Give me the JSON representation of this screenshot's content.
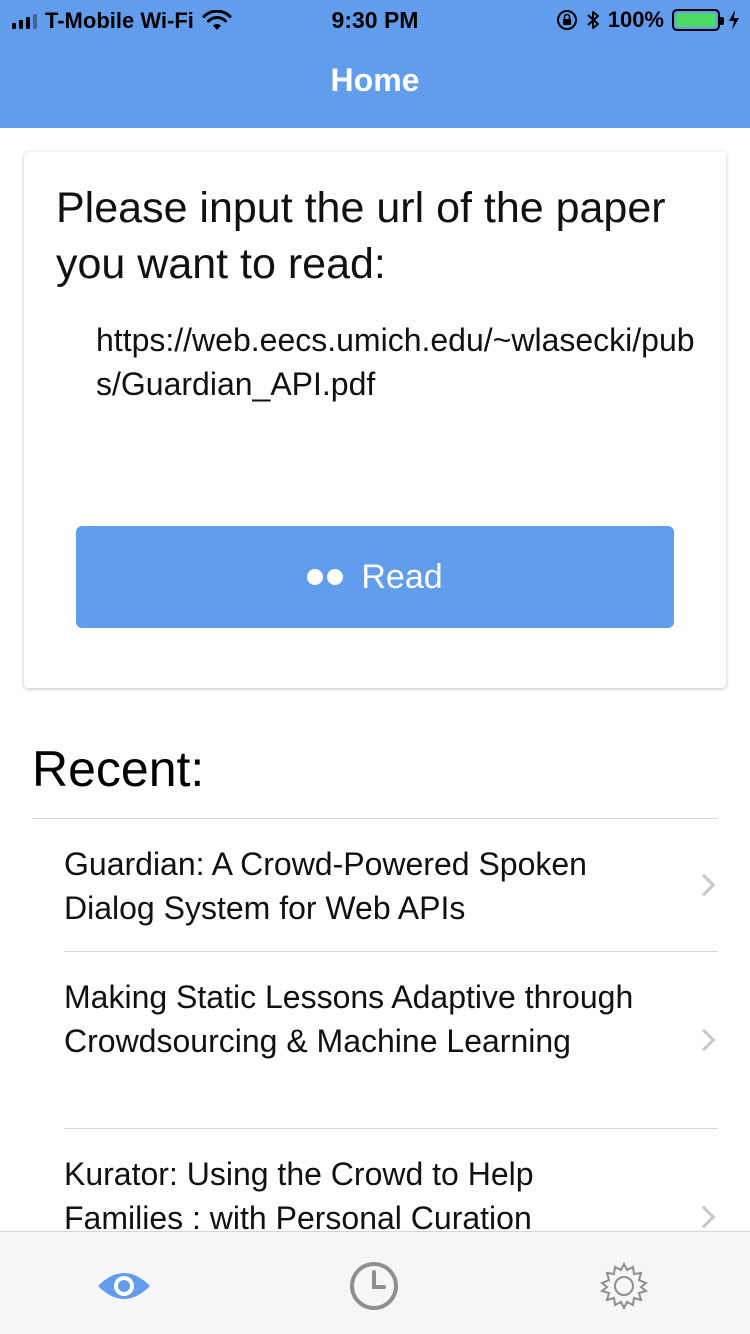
{
  "status_bar": {
    "carrier": "T-Mobile Wi-Fi",
    "time": "9:30 PM",
    "battery": "100%"
  },
  "nav": {
    "title": "Home"
  },
  "card": {
    "prompt": "Please input the url of the paper you want to read:",
    "url_value": "https://web.eecs.umich.edu/~wlasecki/pubs/Guardian_API.pdf",
    "read_label": "Read"
  },
  "recent": {
    "title": "Recent:",
    "items": [
      {
        "label": "Guardian: A Crowd-Powered Spoken Dialog System for Web APIs"
      },
      {
        "label": "Making Static Lessons Adaptive through Crowdsourcing & Machine Learning"
      },
      {
        "label": "Kurator: Using the Crowd to Help Families : with Personal Curation"
      }
    ]
  },
  "tabbar": {
    "tabs": [
      {
        "icon": "eye-icon",
        "active": true
      },
      {
        "icon": "clock-icon",
        "active": false
      },
      {
        "icon": "gear-icon",
        "active": false
      }
    ]
  },
  "colors": {
    "accent": "#629ded",
    "tab_inactive": "#8e8e93",
    "battery_fill": "#4cd964"
  }
}
